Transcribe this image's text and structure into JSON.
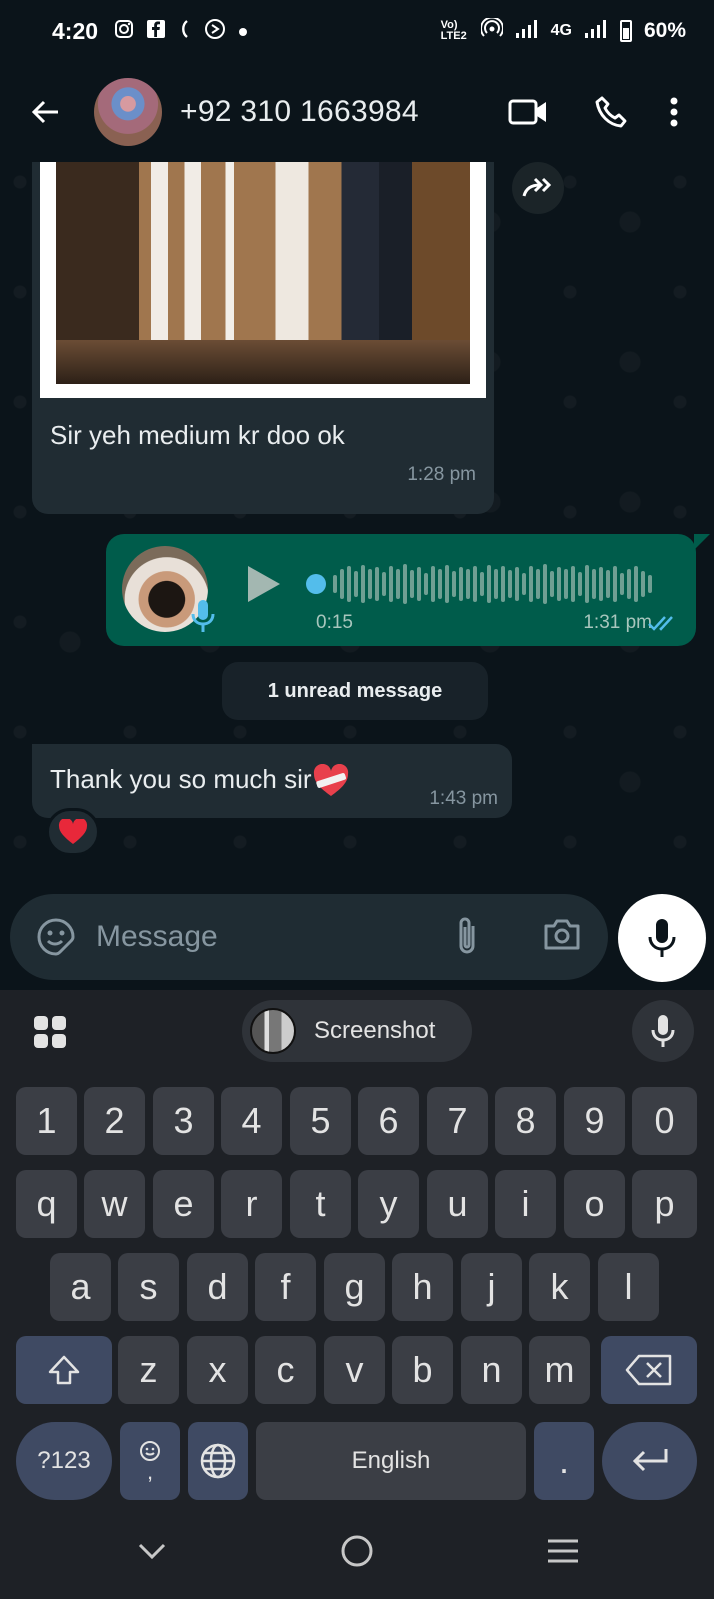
{
  "status_bar": {
    "time": "4:20",
    "network_label": "Vo) LTE2",
    "cell_label": "4G",
    "battery": "60%"
  },
  "header": {
    "contact": "+92 310 1663984"
  },
  "messages": {
    "image_caption": "Sir yeh medium kr doo ok",
    "image_time": "1:28 pm",
    "voice_duration": "0:15",
    "voice_time": "1:31 pm",
    "unread_label": "1 unread message",
    "thanks_text": "Thank you so much sir",
    "thanks_time": "1:43 pm"
  },
  "input": {
    "placeholder": "Message"
  },
  "keyboard": {
    "suggestion": "Screenshot",
    "numbers": [
      "1",
      "2",
      "3",
      "4",
      "5",
      "6",
      "7",
      "8",
      "9",
      "0"
    ],
    "row1": [
      "q",
      "w",
      "e",
      "r",
      "t",
      "y",
      "u",
      "i",
      "o",
      "p"
    ],
    "row2": [
      "a",
      "s",
      "d",
      "f",
      "g",
      "h",
      "j",
      "k",
      "l"
    ],
    "row3": [
      "z",
      "x",
      "c",
      "v",
      "b",
      "n",
      "m"
    ],
    "symbols_key": "?123",
    "comma_key": ",",
    "space_label": "English",
    "period_key": "."
  },
  "colors": {
    "outgoing_bubble": "#005c4b",
    "incoming_bubble": "#202c33",
    "read_ticks": "#53bdeb",
    "background": "#0b141a"
  }
}
